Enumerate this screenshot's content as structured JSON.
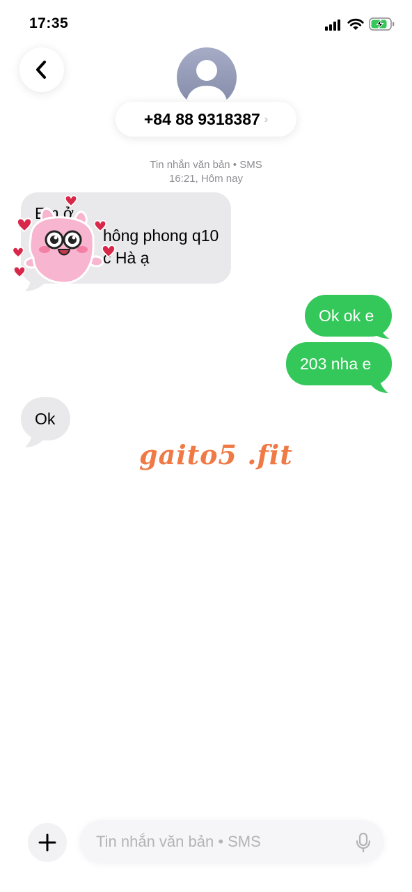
{
  "status_bar": {
    "time": "17:35",
    "icons": [
      "cellular-signal-icon",
      "wifi-icon",
      "battery-charging-icon"
    ]
  },
  "header": {
    "back_icon": "chevron-left-icon",
    "avatar_icon": "person-silhouette-icon",
    "contact_name": "+84 88 9318387",
    "contact_chevron": "›"
  },
  "conversation": {
    "meta_line1": "Tin nhắn văn bản • SMS",
    "meta_line2": "16:21, Hôm nay",
    "messages": [
      {
        "direction": "incoming",
        "lines": [
          "Em ở",
          "hông phong q10",
          "c Hà ạ"
        ]
      },
      {
        "direction": "outgoing",
        "text": "Ok ok e"
      },
      {
        "direction": "outgoing",
        "text": "203 nha e"
      },
      {
        "direction": "incoming",
        "text": "Ok"
      }
    ],
    "sticker": "pink-bunny-hearts-sticker"
  },
  "watermark": "gaito5 .fit",
  "composer": {
    "add_icon": "plus-icon",
    "placeholder": "Tin nhắn văn bản • SMS",
    "value": "",
    "mic_icon": "microphone-icon"
  },
  "colors": {
    "incoming_bubble": "#e9e9eb",
    "outgoing_bubble": "#34c759",
    "meta_text": "#8e8e93",
    "watermark": "#f07a45",
    "battery_fill": "#34c759"
  }
}
